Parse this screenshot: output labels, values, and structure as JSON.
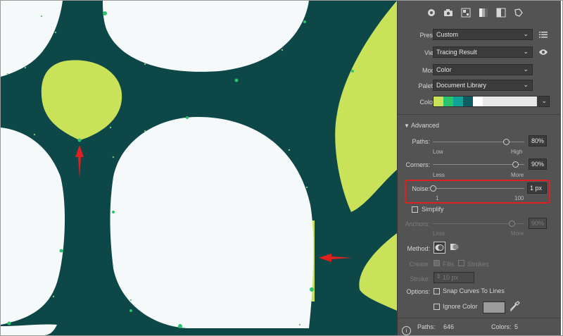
{
  "panel": {
    "preset": {
      "label": "Preset:",
      "value": "Custom"
    },
    "view": {
      "label": "View:",
      "value": "Tracing Result"
    },
    "mode": {
      "label": "Mode:",
      "value": "Color"
    },
    "palette": {
      "label": "Palette:",
      "value": "Document Library"
    },
    "colors": {
      "label": "Colors:",
      "swatches": [
        "#c9e25a",
        "#2bc46e",
        "#11a39a",
        "#0f5c61",
        "#ffffff"
      ]
    },
    "advanced": {
      "label": "Advanced"
    },
    "paths": {
      "label": "Paths:",
      "value": "80%",
      "low": "Low",
      "high": "High",
      "level": 0.8
    },
    "corners": {
      "label": "Corners:",
      "value": "90%",
      "low": "Less",
      "high": "More",
      "level": 0.9
    },
    "noise": {
      "label": "Noise:",
      "value": "1 px",
      "min": "1",
      "max": "100",
      "level": 0.0
    },
    "simplify": {
      "label": "Simplify"
    },
    "anchors": {
      "label": "Anchors:",
      "value": "90%",
      "low": "Less",
      "high": "More"
    },
    "method": {
      "label": "Method:"
    },
    "create": {
      "label": "Create:",
      "fills": "Fills",
      "strokes": "Strokes"
    },
    "stroke": {
      "label": "Stroke:",
      "value": "10 px"
    },
    "options": {
      "label": "Options:",
      "snap": "Snap Curves To Lines",
      "ignore": "Ignore Color"
    },
    "footer": {
      "paths_label": "Paths:",
      "paths_value": "646",
      "colors_label": "Colors:",
      "colors_value": "5"
    }
  },
  "colors": {
    "dark_teal": "#0e4747",
    "lime": "#c9e25a",
    "white": "#f6f9f9",
    "highlight": "#e02020"
  }
}
